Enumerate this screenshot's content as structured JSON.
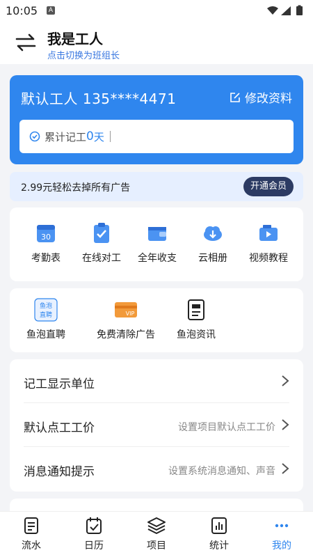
{
  "status": {
    "time": "10:05",
    "notif_letter": "A"
  },
  "header": {
    "title": "我是工人",
    "subtitle": "点击切换为班组长"
  },
  "profile": {
    "name": "默认工人",
    "phone": "135****4471",
    "edit_label": "修改资料",
    "workdays_label": "累计记工",
    "workdays_value": "0",
    "workdays_unit": "天"
  },
  "ad": {
    "text": "2.99元轻松去掉所有广告",
    "button": "开通会员"
  },
  "grid1": [
    {
      "label": "考勤表",
      "icon": "calendar-30-icon"
    },
    {
      "label": "在线对工",
      "icon": "clipboard-check-icon"
    },
    {
      "label": "全年收支",
      "icon": "wallet-icon"
    },
    {
      "label": "云相册",
      "icon": "cloud-download-icon"
    },
    {
      "label": "视频教程",
      "icon": "video-icon"
    }
  ],
  "grid2": [
    {
      "label": "鱼泡直聘",
      "icon": "yupao-recruit-icon",
      "badge_line1": "鱼泡",
      "badge_line2": "直聘"
    },
    {
      "label": "免费清除广告",
      "icon": "vip-card-icon",
      "badge": "VIP"
    },
    {
      "label": "鱼泡资讯",
      "icon": "news-document-icon"
    }
  ],
  "settings": [
    {
      "title": "记工显示单位",
      "hint": ""
    },
    {
      "title": "默认点工工价",
      "hint": "设置项目默认点工工价"
    },
    {
      "title": "消息通知提示",
      "hint": "设置系统消息通知、声音"
    }
  ],
  "tabs": [
    {
      "label": "流水",
      "icon": "document-icon"
    },
    {
      "label": "日历",
      "icon": "calendar-check-icon"
    },
    {
      "label": "项目",
      "icon": "layers-icon"
    },
    {
      "label": "统计",
      "icon": "bar-chart-icon"
    },
    {
      "label": "我的",
      "icon": "more-dots-icon"
    }
  ],
  "colors": {
    "primary": "#2f86ee",
    "vip_button": "#2c3b63",
    "ad_bg": "#e6efff",
    "page_bg": "#f3f4f7"
  }
}
